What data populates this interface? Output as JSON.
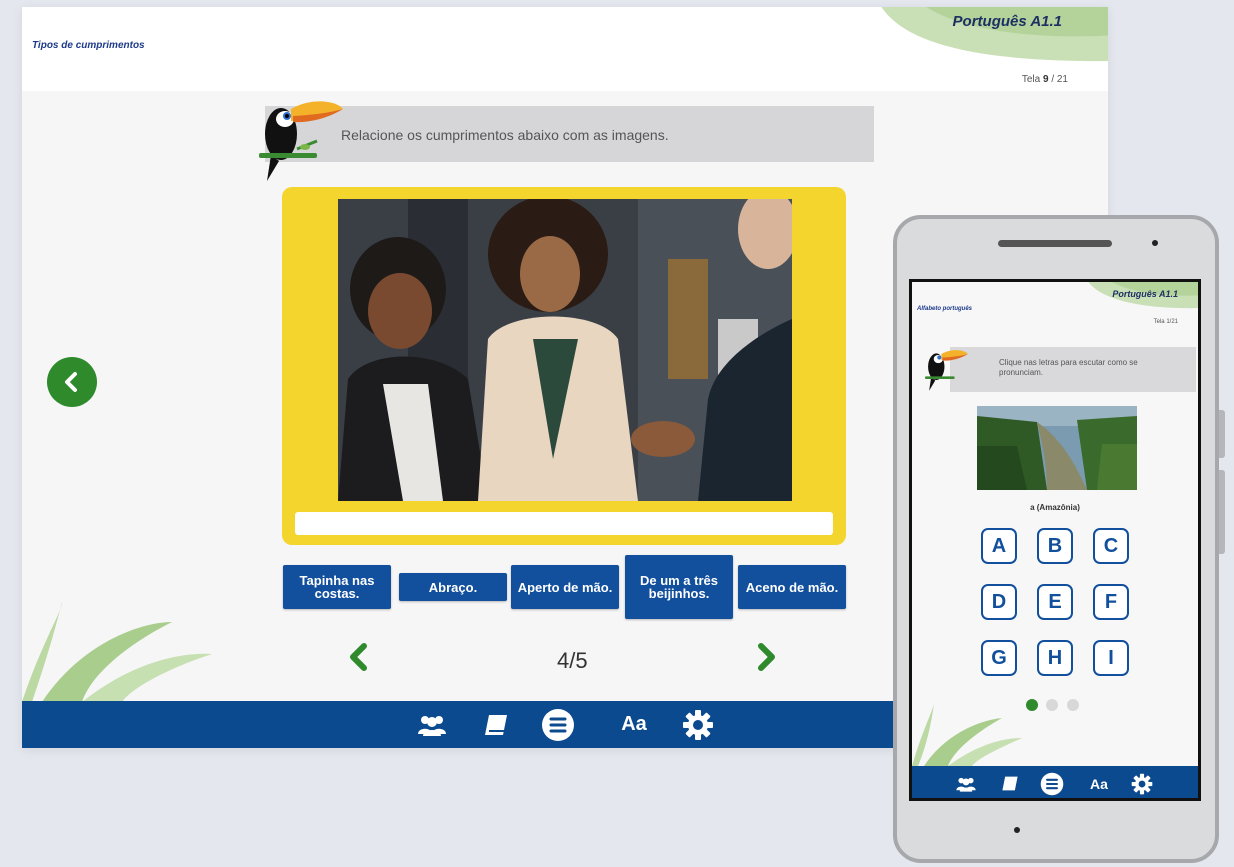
{
  "desktop": {
    "course_title": "Português A1.1",
    "breadcrumb": "Tipos de cumprimentos",
    "screen_label": "Tela",
    "screen_current": "9",
    "screen_total": "/ 21",
    "instruction": "Relacione os cumprimentos abaixo com as imagens.",
    "choices": [
      "Tapinha nas costas.",
      "Abraço.",
      "Aperto de mão.",
      "De um a três beijinhos.",
      "Aceno de mão."
    ],
    "pager": "4/5",
    "toolbar": {
      "font_label": "Aa"
    },
    "colors": {
      "primary_blue": "#124f9c",
      "toolbar_blue": "#0b4a8e",
      "yellow": "#f3d52e",
      "green": "#2e8a2b"
    }
  },
  "phone": {
    "course_title": "Português A1.1",
    "breadcrumb": "Alfabeto português",
    "screen_count": "Tela 1/21",
    "instruction": "Clique nas letras para escutar como se pronunciam.",
    "caption": "a (Amazônia)",
    "letters": [
      "A",
      "B",
      "C",
      "D",
      "E",
      "F",
      "G",
      "H",
      "I"
    ],
    "carousel": {
      "pages": 3,
      "active": 1
    },
    "toolbar": {
      "font_label": "Aa"
    }
  }
}
